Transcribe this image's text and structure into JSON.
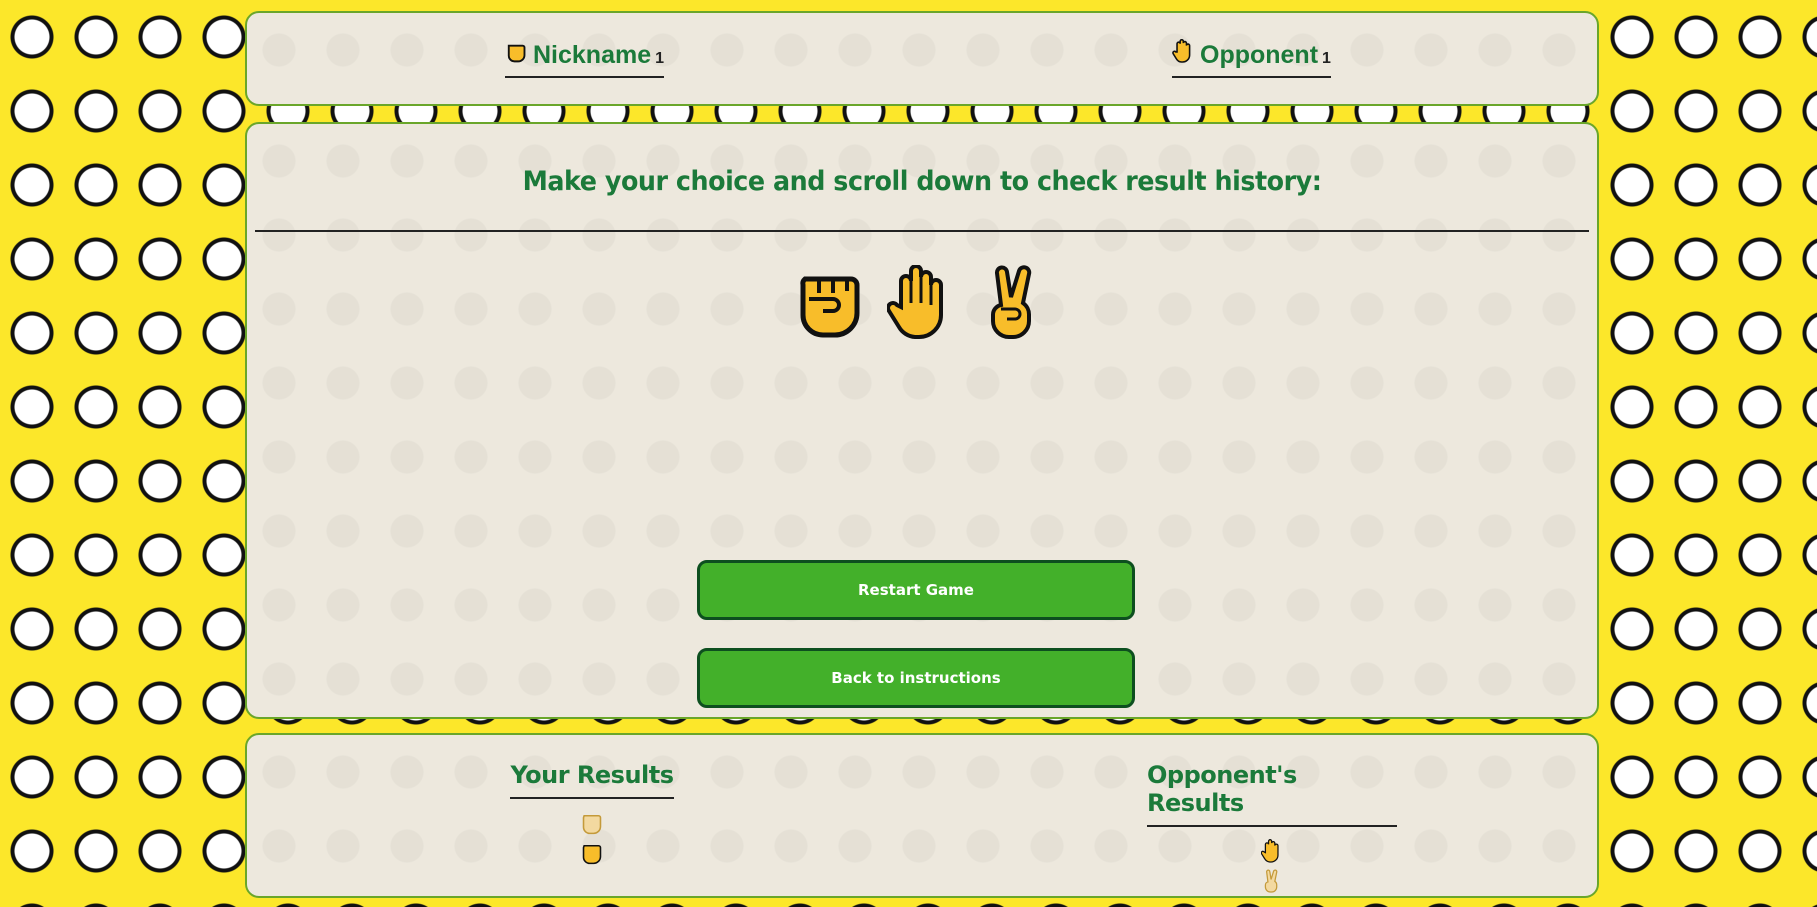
{
  "score": {
    "player": {
      "name": "Nickname",
      "score": "1",
      "icon": "fist-icon"
    },
    "opponent": {
      "name": "Opponent",
      "score": "1",
      "icon": "raised-hand-icon"
    }
  },
  "game": {
    "prompt": "Make your choice and scroll down to check result history:",
    "choices": [
      {
        "name": "rock",
        "icon": "raised-fist-icon"
      },
      {
        "name": "paper",
        "icon": "raised-hand-icon"
      },
      {
        "name": "scissors",
        "icon": "victory-hand-icon"
      }
    ],
    "restart_label": "Restart Game",
    "back_label": "Back to instructions"
  },
  "history": {
    "your_title": "Your Results",
    "opponent_title": "Opponent's Results",
    "your_results": [
      "fist-icon",
      "fist-icon"
    ],
    "opponent_results": [
      "raised-hand-icon",
      "victory-hand-icon"
    ]
  },
  "colors": {
    "background": "#fce72a",
    "panel": "#ede8dd",
    "accent_green": "#1b7a3a",
    "button_green": "#43b02a",
    "hand_yellow": "#f8bd2a"
  }
}
